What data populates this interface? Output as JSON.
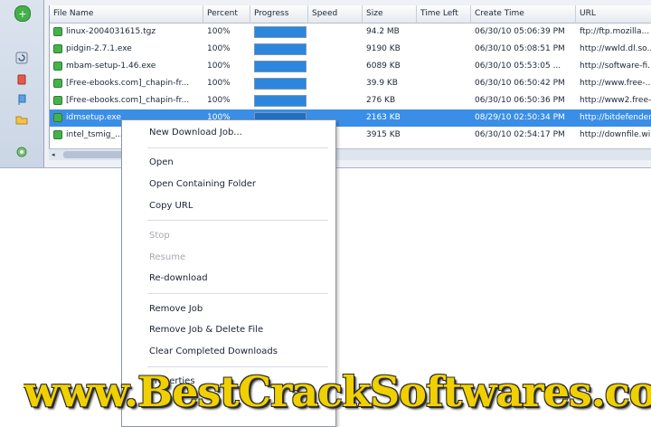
{
  "columns": {
    "file_name": "File Name",
    "percent": "Percent",
    "progress": "Progress",
    "speed": "Speed",
    "size": "Size",
    "time_left": "Time Left",
    "create_time": "Create Time",
    "url": "URL"
  },
  "rows": [
    {
      "name": "linux-2004031615.tgz",
      "percent": "100%",
      "progress": 1.0,
      "size": "94.2 MB",
      "create_time": "06/30/10 05:06:39 PM",
      "url": "ftp://ftp.mozilla..."
    },
    {
      "name": "pidgin-2.7.1.exe",
      "percent": "100%",
      "progress": 1.0,
      "size": "9190 KB",
      "create_time": "06/30/10 05:08:51 PM",
      "url": "http://wwld.dl.so..."
    },
    {
      "name": "mbam-setup-1.46.exe",
      "percent": "100%",
      "progress": 1.0,
      "size": "6089 KB",
      "create_time": "06/30/10 05:53:05 ...",
      "url": "http://software-fi..."
    },
    {
      "name": "[Free-ebooks.com]_chapin-fr...",
      "percent": "100%",
      "progress": 1.0,
      "size": "39.9 KB",
      "create_time": "06/30/10 06:50:42 PM",
      "url": "http://www.free-..."
    },
    {
      "name": "[Free-ebooks.com]_chapin-fr...",
      "percent": "100%",
      "progress": 1.0,
      "size": "276 KB",
      "create_time": "06/30/10 06:50:36 PM",
      "url": "http://www2.free-..."
    },
    {
      "name": "idmsetup.exe",
      "percent": "100%",
      "progress": 1.0,
      "size": "2163 KB",
      "create_time": "08/29/10 02:50:34 PM",
      "url": "http://bitdefender..."
    },
    {
      "name": "intel_tsmig_...",
      "percent": "",
      "progress": 0.0,
      "size": "3915 KB",
      "create_time": "06/30/10 02:54:17 PM",
      "url": "http://downfile.wi..."
    }
  ],
  "context_menu": {
    "new_download_job": "New Download Job...",
    "open": "Open",
    "open_containing_folder": "Open Containing Folder",
    "copy_url": "Copy URL",
    "stop": "Stop",
    "resume": "Resume",
    "redownload": "Re-download",
    "remove_job": "Remove Job",
    "remove_job_delete": "Remove Job & Delete File",
    "clear_completed": "Clear Completed Downloads",
    "properties": "Properties"
  },
  "watermark": "www.BestCrackSoftwares.com",
  "colors": {
    "selection": "#3a8ee6",
    "progress_fill": "#2c86dd",
    "watermark": "#f0d000"
  },
  "icons": [
    "add-icon",
    "refresh-icon",
    "delete-icon",
    "flag-icon",
    "folder-icon",
    "settings-icon",
    "file-icon",
    "scroll-left-icon"
  ]
}
